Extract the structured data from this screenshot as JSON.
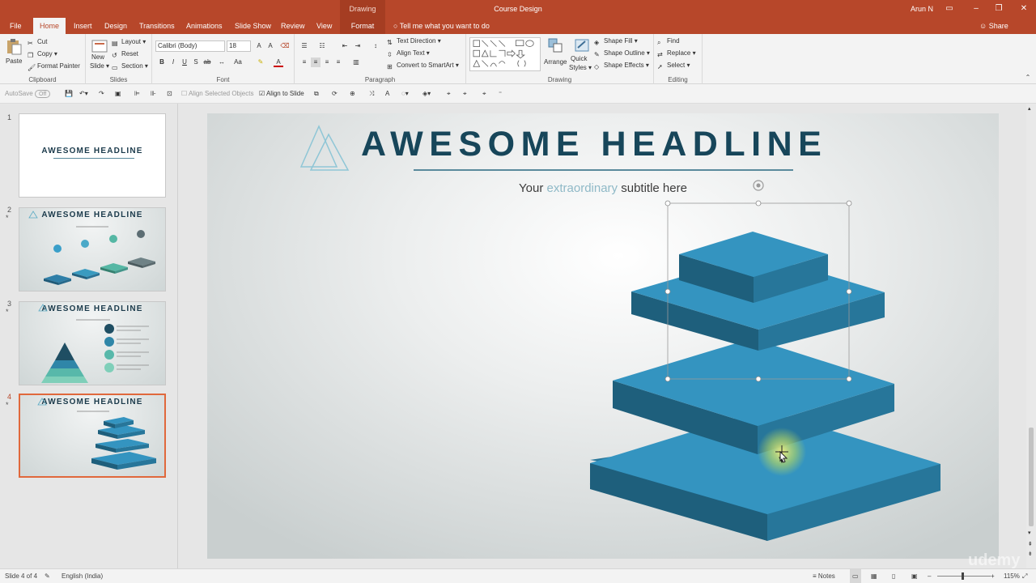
{
  "window": {
    "context_label": "Drawing Tools",
    "doc_title": "Course Design",
    "user": "Arun N"
  },
  "tabs": [
    "File",
    "Home",
    "Insert",
    "Design",
    "Transitions",
    "Animations",
    "Slide Show",
    "Review",
    "View",
    "Format"
  ],
  "tell_me": "Tell me what you want to do",
  "share": "Share",
  "ribbon": {
    "clipboard": {
      "paste": "Paste",
      "cut": "Cut",
      "copy": "Copy",
      "format_painter": "Format Painter",
      "label": "Clipboard"
    },
    "slides": {
      "new_slide_1": "New",
      "new_slide_2": "Slide",
      "layout": "Layout",
      "reset": "Reset",
      "section": "Section",
      "label": "Slides"
    },
    "font": {
      "name": "Calibri (Body)",
      "size": "18",
      "label": "Font"
    },
    "paragraph": {
      "text_direction": "Text Direction",
      "align_text": "Align Text",
      "convert": "Convert to SmartArt",
      "label": "Paragraph"
    },
    "drawing": {
      "arrange": "Arrange",
      "quick_styles_1": "Quick",
      "quick_styles_2": "Styles",
      "shape_fill": "Shape Fill",
      "shape_outline": "Shape Outline",
      "shape_effects": "Shape Effects",
      "label": "Drawing"
    },
    "editing": {
      "find": "Find",
      "replace": "Replace",
      "select": "Select",
      "label": "Editing"
    }
  },
  "qat": {
    "autosave": "AutoSave",
    "autosave_state": "Off",
    "align_selected": "Align Selected Objects",
    "align_to_slide": "Align to Slide"
  },
  "thumbnails": [
    {
      "num": "1",
      "title": "AWESOME HEADLINE",
      "star": ""
    },
    {
      "num": "2",
      "title": "AWESOME HEADLINE",
      "star": "*"
    },
    {
      "num": "3",
      "title": "AWESOME HEADLINE",
      "star": "*"
    },
    {
      "num": "4",
      "title": "AWESOME HEADLINE",
      "star": "*"
    }
  ],
  "slide": {
    "headline": "AWESOME HEADLINE",
    "subtitle_pre": "Your ",
    "subtitle_accent": "extraordinary",
    "subtitle_post": " subtitle here",
    "colors": {
      "headline": "#17465a",
      "accent": "#8fb9c7",
      "top": "#3494c0",
      "left": "#1e5f7c",
      "right": "#27769a"
    }
  },
  "status": {
    "slide_info": "Slide 4 of 4",
    "language": "English (India)",
    "notes": "Notes",
    "zoom": "115%",
    "watermark": "udemy"
  }
}
